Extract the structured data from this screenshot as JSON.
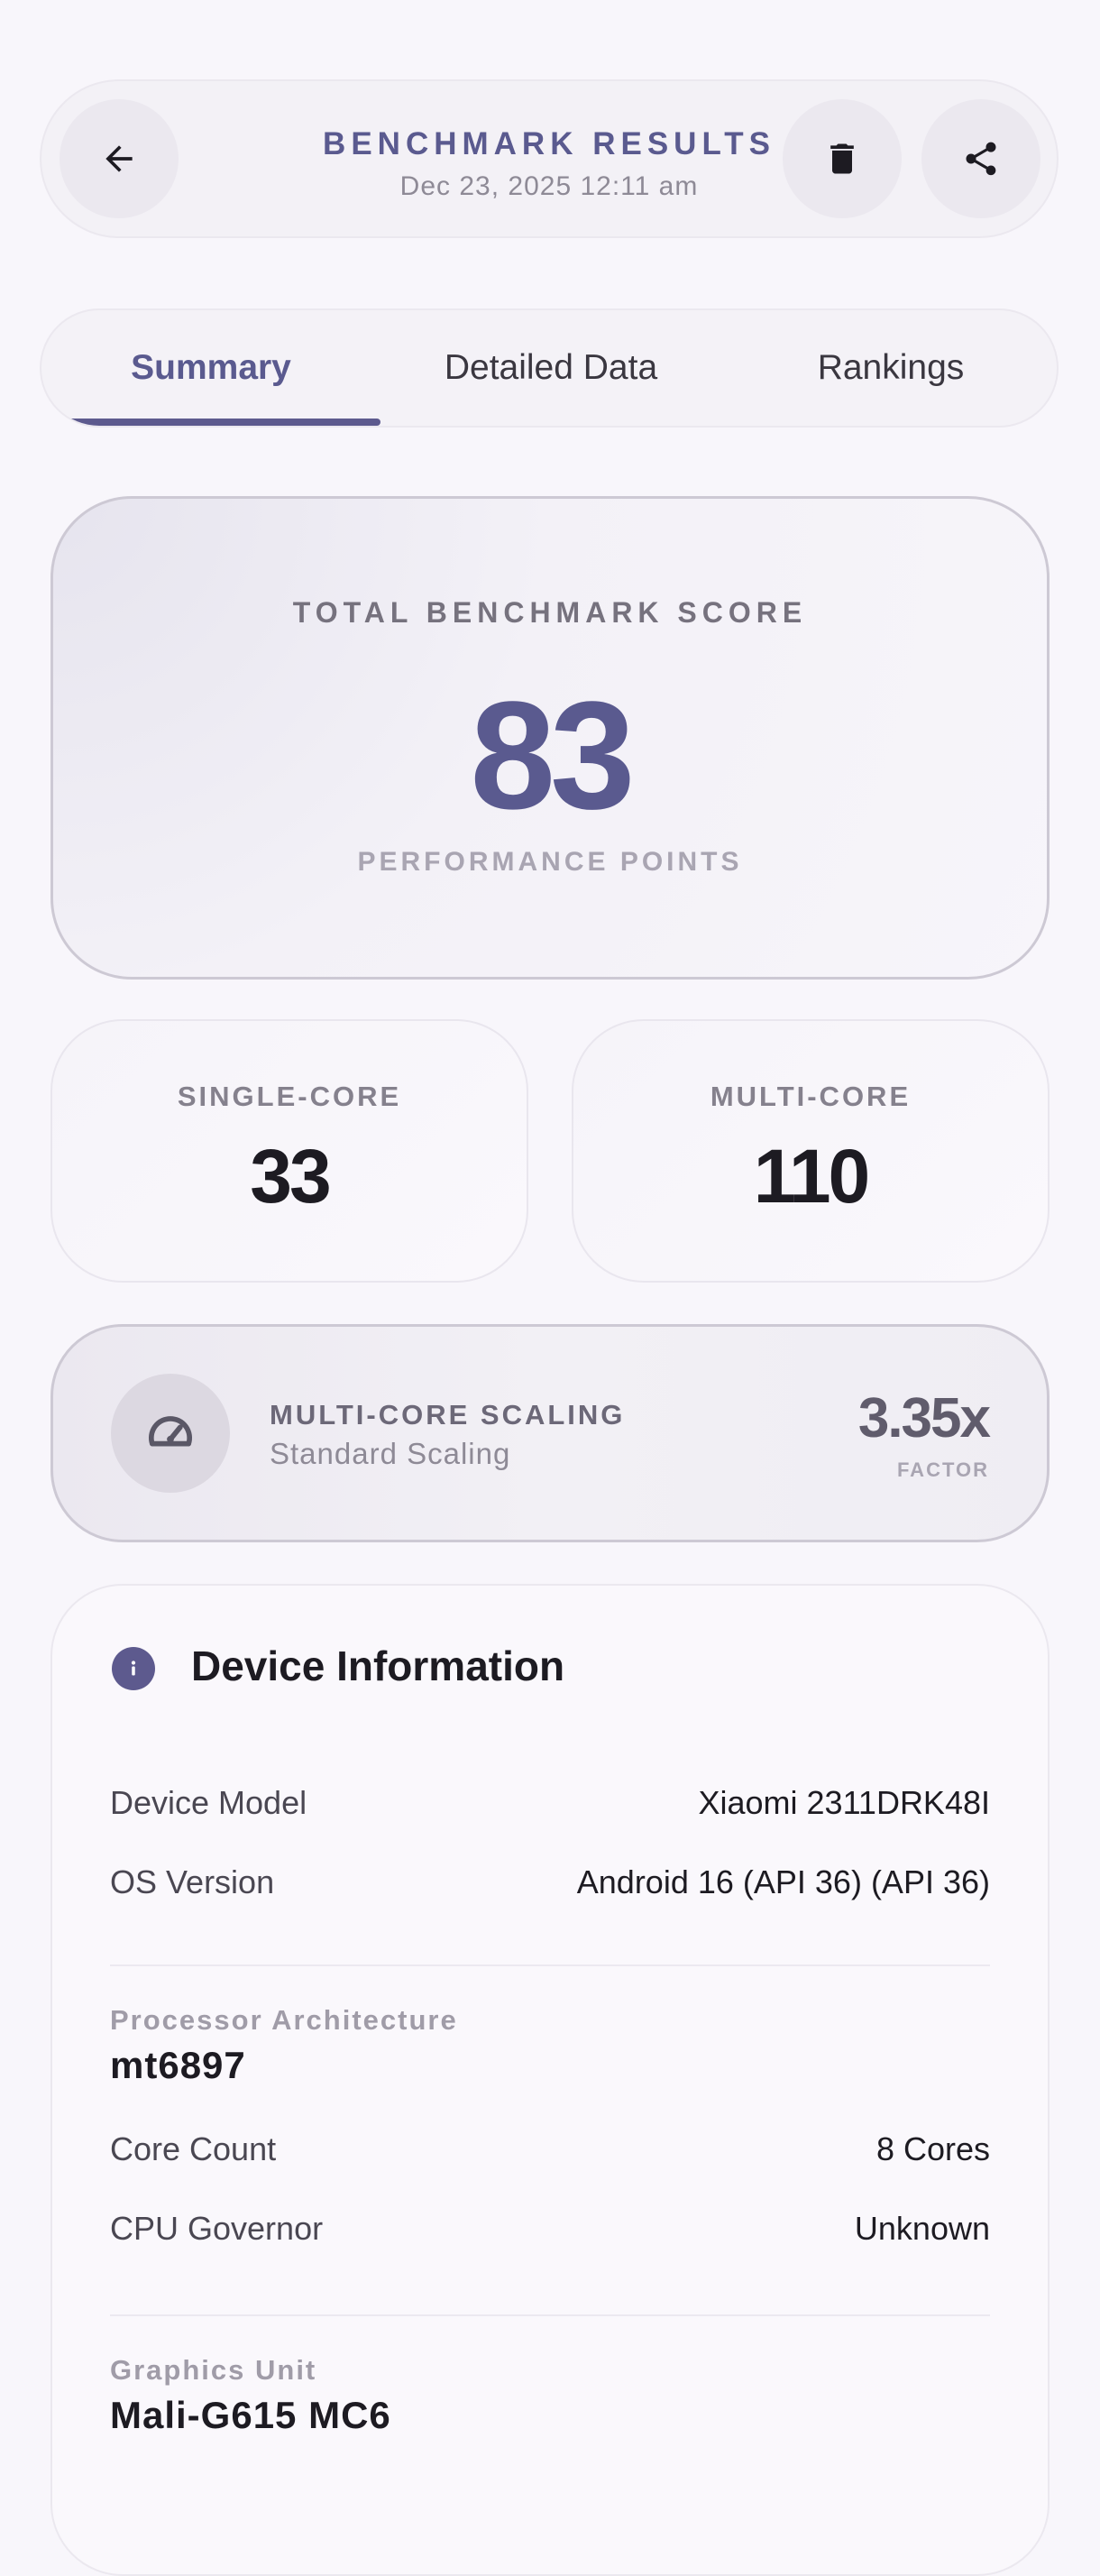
{
  "header": {
    "title": "BENCHMARK RESULTS",
    "datetime": "Dec 23, 2025 12:11 am",
    "back_icon": "arrow-left-icon",
    "delete_icon": "trash-icon",
    "share_icon": "share-icon"
  },
  "tabs": [
    {
      "label": "Summary",
      "active": true
    },
    {
      "label": "Detailed Data",
      "active": false
    },
    {
      "label": "Rankings",
      "active": false
    }
  ],
  "total": {
    "label": "TOTAL BENCHMARK SCORE",
    "value": "83",
    "unit": "PERFORMANCE POINTS"
  },
  "single_core": {
    "label": "SINGLE-CORE",
    "value": "33"
  },
  "multi_core": {
    "label": "MULTI-CORE",
    "value": "110"
  },
  "scaling": {
    "icon": "speedometer-icon",
    "title": "MULTI-CORE SCALING",
    "subtitle": "Standard Scaling",
    "value": "3.35x",
    "factor_label": "FACTOR"
  },
  "device": {
    "icon": "info-icon",
    "title": "Device Information",
    "rows": [
      {
        "key": "Device Model",
        "value": "Xiaomi 2311DRK48I"
      },
      {
        "key": "OS Version",
        "value": "Android 16 (API 36) (API 36)"
      }
    ],
    "processor": {
      "label": "Processor Architecture",
      "value": "mt6897",
      "rows": [
        {
          "key": "Core Count",
          "value": "8 Cores"
        },
        {
          "key": "CPU Governor",
          "value": "Unknown"
        }
      ]
    },
    "graphics": {
      "label": "Graphics Unit",
      "value": "Mali-G615 MC6"
    }
  },
  "colors": {
    "accent": "#5a5a8f",
    "background": "#f8f6fb",
    "card_border": "#cdc9d4"
  }
}
